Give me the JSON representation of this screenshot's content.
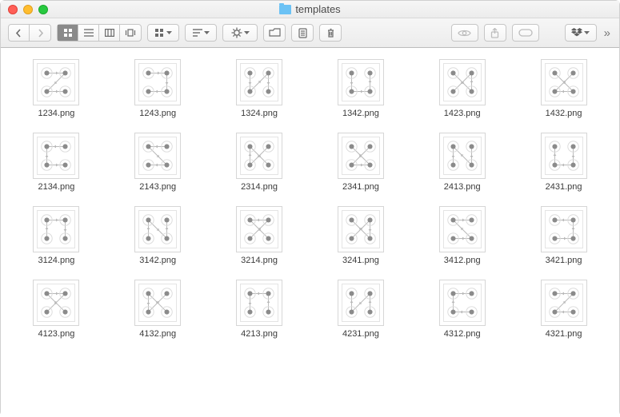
{
  "window": {
    "title": "templates"
  },
  "toolbar": {
    "back": "‹",
    "forward": "›"
  },
  "files": [
    {
      "name": "1234.png",
      "order": [
        1,
        2,
        3,
        4
      ]
    },
    {
      "name": "1243.png",
      "order": [
        1,
        2,
        4,
        3
      ]
    },
    {
      "name": "1324.png",
      "order": [
        1,
        3,
        2,
        4
      ]
    },
    {
      "name": "1342.png",
      "order": [
        1,
        3,
        4,
        2
      ]
    },
    {
      "name": "1423.png",
      "order": [
        1,
        4,
        2,
        3
      ]
    },
    {
      "name": "1432.png",
      "order": [
        1,
        4,
        3,
        2
      ]
    },
    {
      "name": "2134.png",
      "order": [
        2,
        1,
        3,
        4
      ]
    },
    {
      "name": "2143.png",
      "order": [
        2,
        1,
        4,
        3
      ]
    },
    {
      "name": "2314.png",
      "order": [
        2,
        3,
        1,
        4
      ]
    },
    {
      "name": "2341.png",
      "order": [
        2,
        3,
        4,
        1
      ]
    },
    {
      "name": "2413.png",
      "order": [
        2,
        4,
        1,
        3
      ]
    },
    {
      "name": "2431.png",
      "order": [
        2,
        4,
        3,
        1
      ]
    },
    {
      "name": "3124.png",
      "order": [
        3,
        1,
        2,
        4
      ]
    },
    {
      "name": "3142.png",
      "order": [
        3,
        1,
        4,
        2
      ]
    },
    {
      "name": "3214.png",
      "order": [
        3,
        2,
        1,
        4
      ]
    },
    {
      "name": "3241.png",
      "order": [
        3,
        2,
        4,
        1
      ]
    },
    {
      "name": "3412.png",
      "order": [
        3,
        4,
        1,
        2
      ]
    },
    {
      "name": "3421.png",
      "order": [
        3,
        4,
        2,
        1
      ]
    },
    {
      "name": "4123.png",
      "order": [
        4,
        1,
        2,
        3
      ]
    },
    {
      "name": "4132.png",
      "order": [
        4,
        1,
        3,
        2
      ]
    },
    {
      "name": "4213.png",
      "order": [
        4,
        2,
        1,
        3
      ]
    },
    {
      "name": "4231.png",
      "order": [
        4,
        2,
        3,
        1
      ]
    },
    {
      "name": "4312.png",
      "order": [
        4,
        3,
        1,
        2
      ]
    },
    {
      "name": "4321.png",
      "order": [
        4,
        3,
        2,
        1
      ]
    }
  ],
  "pattern": {
    "dot_positions": {
      "1": [
        13,
        13
      ],
      "2": [
        37,
        13
      ],
      "3": [
        13,
        37
      ],
      "4": [
        37,
        37
      ]
    },
    "dot_radius": 3.2,
    "ring_radius": 7,
    "color": "#8b8b8b",
    "line_color": "#b9b9b9"
  }
}
